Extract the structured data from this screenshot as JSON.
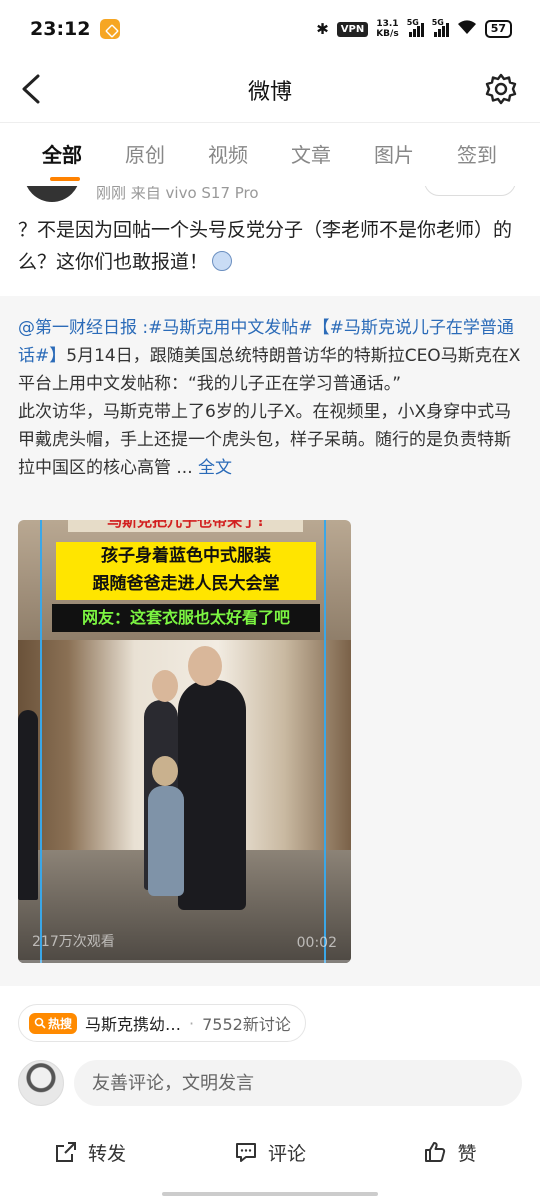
{
  "status_bar": {
    "time": "23:12",
    "vpn": "VPN",
    "net_speed_value": "13.1",
    "net_speed_unit": "KB/s",
    "signal1": "5G",
    "signal2": "5G",
    "battery": "57"
  },
  "nav": {
    "title": "微博"
  },
  "tabs": [
    {
      "label": "全部",
      "active": true
    },
    {
      "label": "原创",
      "active": false
    },
    {
      "label": "视频",
      "active": false
    },
    {
      "label": "文章",
      "active": false
    },
    {
      "label": "图片",
      "active": false
    },
    {
      "label": "签到",
      "active": false
    }
  ],
  "post": {
    "meta": "刚刚 来自 vivo S17 Pro",
    "text": "？不是因为回帖一个头号反党分子（李老师不是你老师）的么？这你们也敢报道！"
  },
  "repost": {
    "author_link": "@第一财经日报",
    "sep": " :",
    "hashtag1": "#马斯克用中文发帖#",
    "hashtag2": "【#马斯克说儿子在学普通话#】",
    "body1": "5月14日，跟随美国总统特朗普访华的特斯拉CEO马斯克在X平台上用中文发帖称：“我的儿子正在学习普通话。”",
    "body2": "此次访华，马斯克带上了6岁的儿子X。在视频里，小X身穿中式马甲戴虎头帽，手上还提一个虎头包，样子呆萌。随行的是负责特斯拉中国区的核心高管 ... ",
    "full_text_link": "全文",
    "video": {
      "caption_top": "马斯克把儿子也带来了!",
      "caption_yellow_line1": "孩子身着蓝色中式服装",
      "caption_yellow_line2": "跟随爸爸走进人民大会堂",
      "caption_dark": "网友：这套衣服也太好看了吧",
      "views": "217万次观看",
      "duration": "00:02"
    }
  },
  "hot": {
    "badge": "热搜",
    "topic": "马斯克携幼…",
    "dot": "·",
    "count": "7552新讨论"
  },
  "comment": {
    "placeholder": "友善评论，文明发言"
  },
  "actions": {
    "repost": "转发",
    "comment": "评论",
    "like": "赞"
  }
}
